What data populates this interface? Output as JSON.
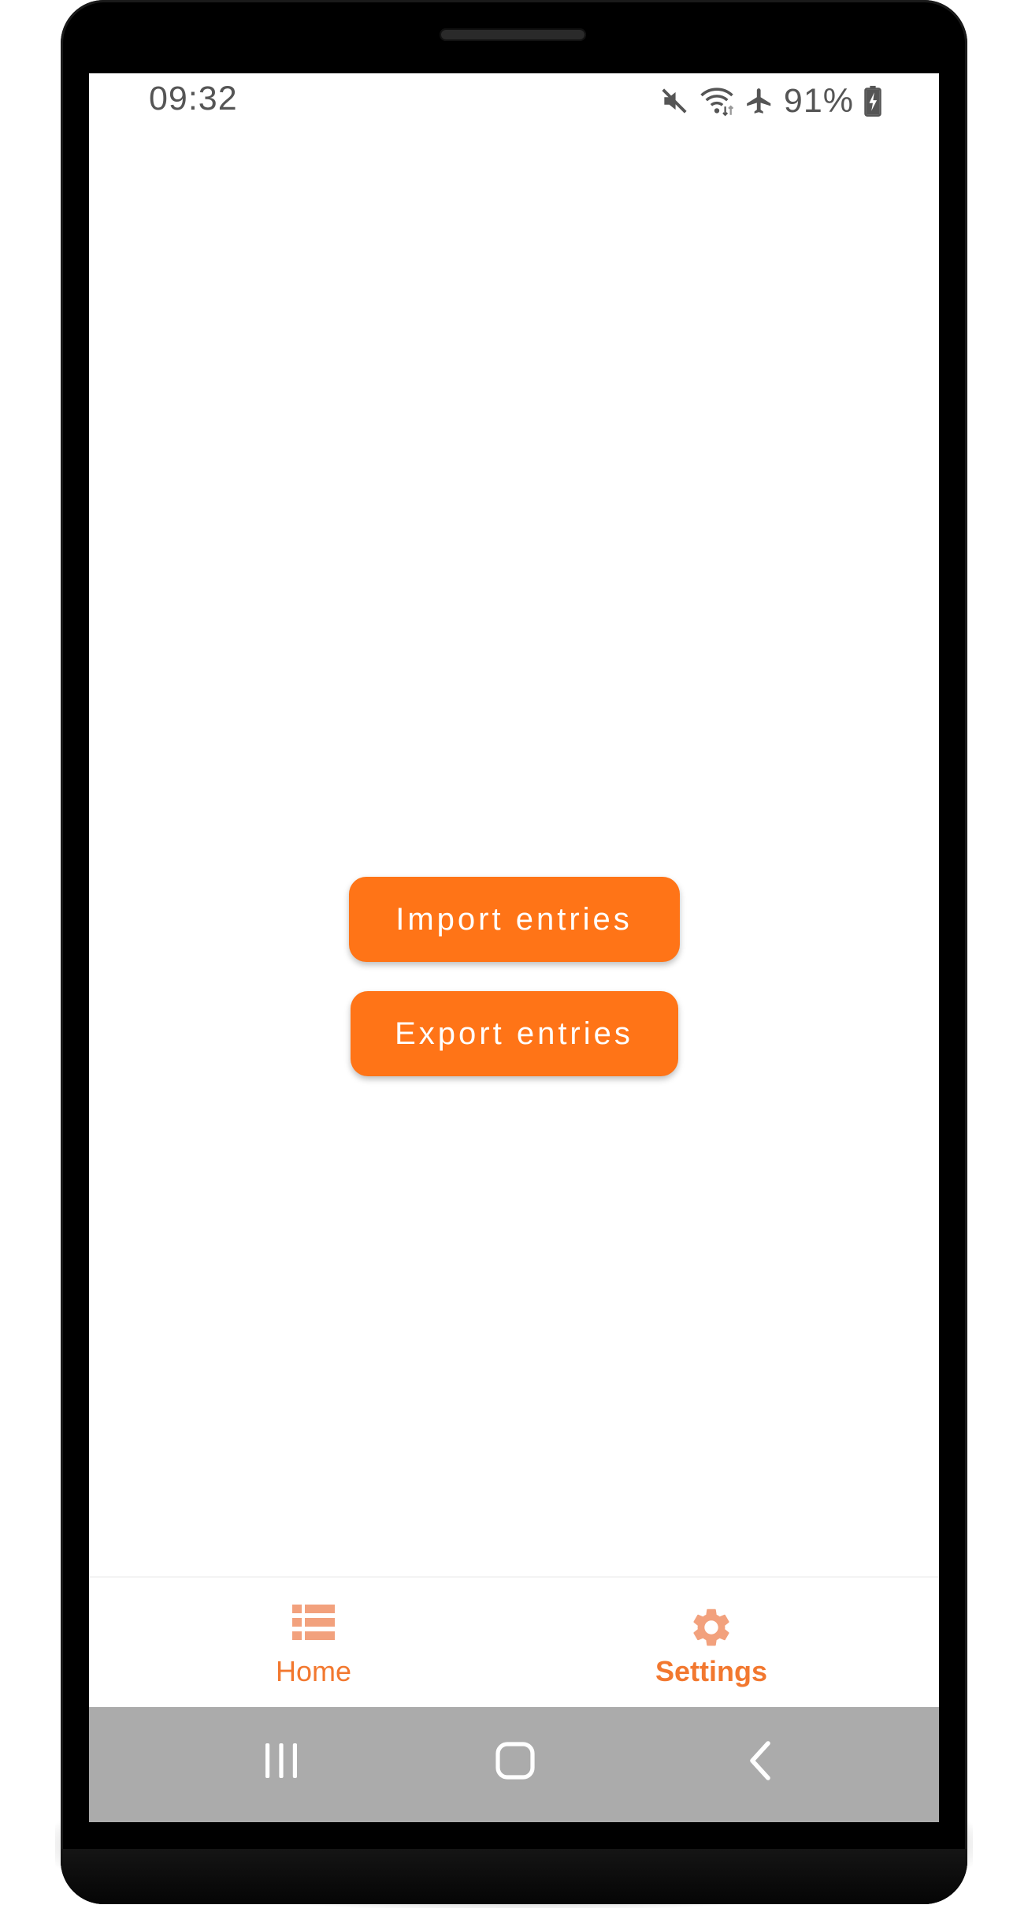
{
  "status_bar": {
    "time": "09:32",
    "battery_percent": "91%",
    "icons": [
      "mute-icon",
      "wifi-icon",
      "airplane-mode-icon",
      "battery-charging-icon"
    ]
  },
  "main": {
    "import_label": "Import entries",
    "export_label": "Export entries",
    "button_color": "#ff7417"
  },
  "bottom_nav": {
    "items": [
      {
        "label": "Home",
        "icon": "list-icon",
        "selected": false
      },
      {
        "label": "Settings",
        "icon": "gear-icon",
        "selected": true
      }
    ],
    "accent_color": "#f2782f"
  },
  "system_nav": {
    "buttons": [
      "recent-apps-icon",
      "home-icon",
      "back-icon"
    ]
  }
}
